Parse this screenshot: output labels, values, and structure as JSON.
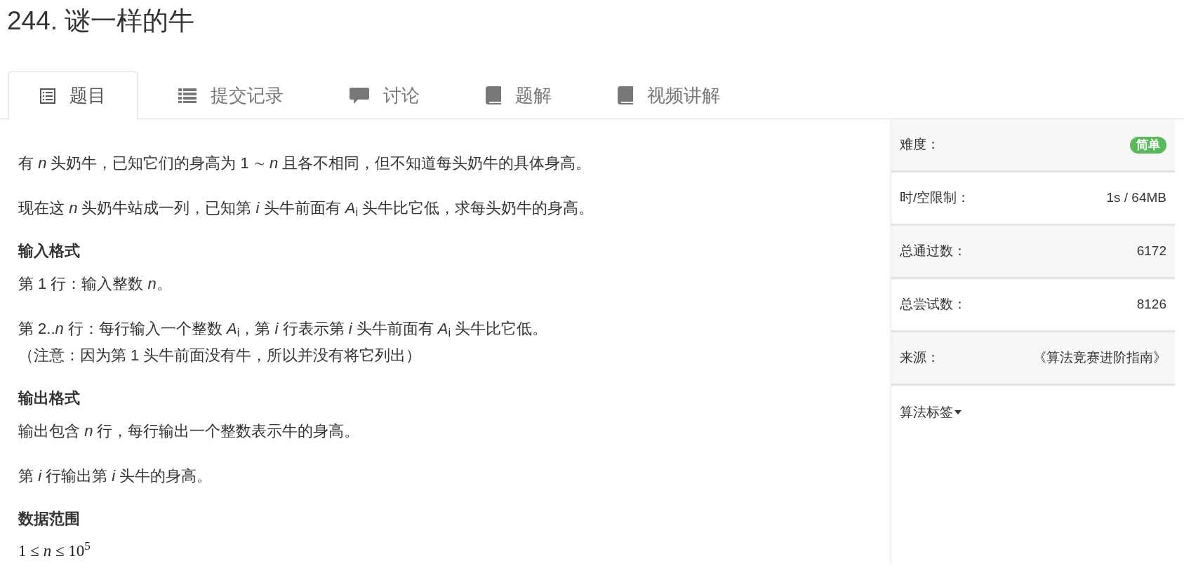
{
  "title": "244. 谜一样的牛",
  "tabs": [
    {
      "label": "题目",
      "selected": true,
      "kind": "list-alt"
    },
    {
      "label": "提交记录",
      "selected": false,
      "kind": "list"
    },
    {
      "label": "讨论",
      "selected": false,
      "kind": "comment"
    },
    {
      "label": "题解",
      "selected": false,
      "kind": "book"
    },
    {
      "label": "视频讲解",
      "selected": false,
      "kind": "book"
    }
  ],
  "content": [
    {
      "kind": "paragraph",
      "lines": [
        "有 *n* 头奶牛，已知它们的身高为 1 ∼ *n* 且各不相同，但不知道每头奶牛的具体身高。"
      ]
    },
    {
      "kind": "paragraph",
      "lines": [
        "现在这 *n* 头奶牛站成一列，已知第 *i* 头牛前面有 *A*$_{i}$ 头牛比它低，求每头奶牛的身高。"
      ]
    },
    {
      "kind": "heading",
      "lines": [
        "输入格式"
      ]
    },
    {
      "kind": "paragraph",
      "lines": [
        "第 1 行：输入整数 *n*。"
      ]
    },
    {
      "kind": "paragraph",
      "lines": [
        "第 2..*n* 行：每行输入一个整数 *A*$_{i}$，第 *i* 行表示第 *i* 头牛前面有 *A*$_{i}$ 头牛比它低。",
        "（注意：因为第 1 头牛前面没有牛，所以并没有将它列出）"
      ]
    },
    {
      "kind": "heading",
      "lines": [
        "输出格式"
      ]
    },
    {
      "kind": "paragraph",
      "lines": [
        "输出包含 *n* 行，每行输出一个整数表示牛的身高。"
      ]
    },
    {
      "kind": "paragraph",
      "lines": [
        "第 *i* 行输出第 *i* 头牛的身高。"
      ]
    },
    {
      "kind": "heading",
      "lines": [
        "数据范围"
      ]
    },
    {
      "kind": "math",
      "lines": [
        "1 ≤ *n* ≤ 10$^{5}$"
      ]
    }
  ],
  "sidebar": [
    {
      "kind": "badge",
      "label": "难度：",
      "value": "简单"
    },
    {
      "kind": "text",
      "label": "时/空限制：",
      "value": "1s / 64MB"
    },
    {
      "kind": "text",
      "label": "总通过数：",
      "value": "6172"
    },
    {
      "kind": "text",
      "label": "总尝试数：",
      "value": "8126"
    },
    {
      "kind": "text",
      "label": "来源：",
      "value": "《算法竞赛进阶指南》"
    },
    {
      "kind": "dropdown",
      "label": "算法标签"
    }
  ]
}
